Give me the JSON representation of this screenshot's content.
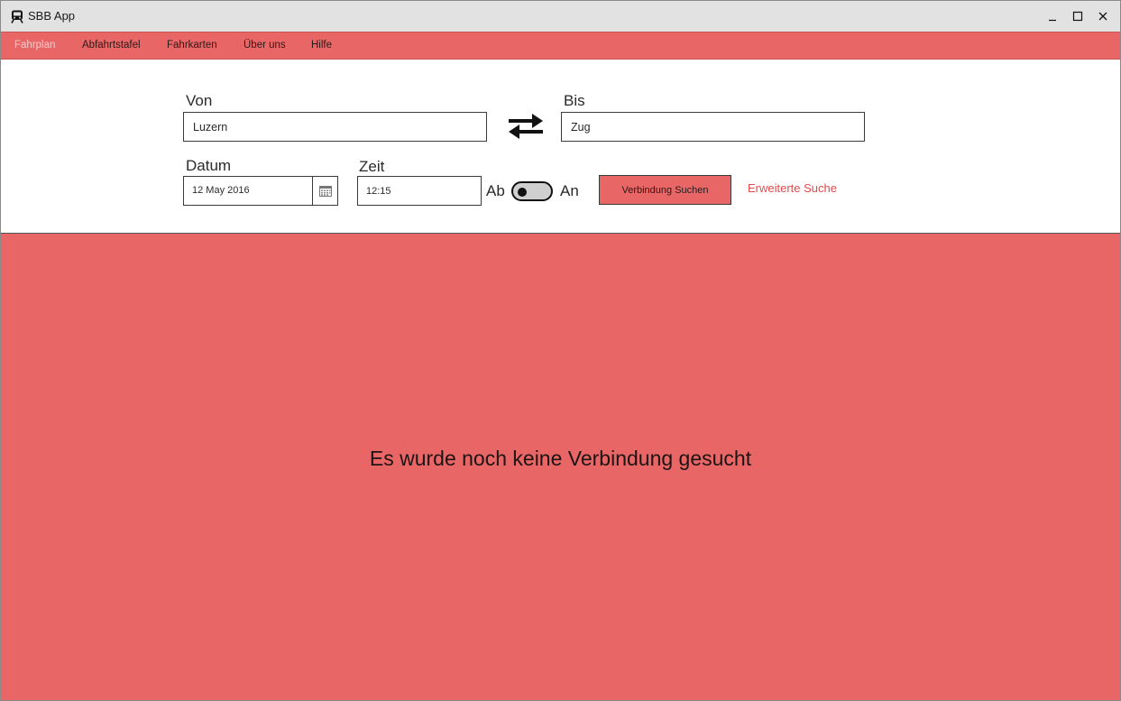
{
  "window": {
    "title": "SBB App",
    "icon": "train-icon"
  },
  "menu": {
    "items": [
      {
        "label": "Fahrplan",
        "active": true
      },
      {
        "label": "Abfahrtstafel",
        "active": false
      },
      {
        "label": "Fahrkarten",
        "active": false
      },
      {
        "label": "Über uns",
        "active": false
      },
      {
        "label": "Hilfe",
        "active": false
      }
    ]
  },
  "form": {
    "from": {
      "label": "Von",
      "value": "Luzern"
    },
    "to": {
      "label": "Bis",
      "value": "Zug"
    },
    "date": {
      "label": "Datum",
      "value": "12 May 2016"
    },
    "time": {
      "label": "Zeit",
      "value": "12:15"
    },
    "toggle": {
      "left_label": "Ab",
      "right_label": "An",
      "state": "Ab"
    },
    "search_button": "Verbindung Suchen",
    "advanced_link": "Erweiterte Suche"
  },
  "results": {
    "empty_message": "Es wurde noch keine Verbindung gesucht"
  },
  "colors": {
    "accent": "#e96666",
    "link": "#e24a4a",
    "titlebar": "#e2e2e2",
    "active_menu": "#f6c9c9"
  }
}
